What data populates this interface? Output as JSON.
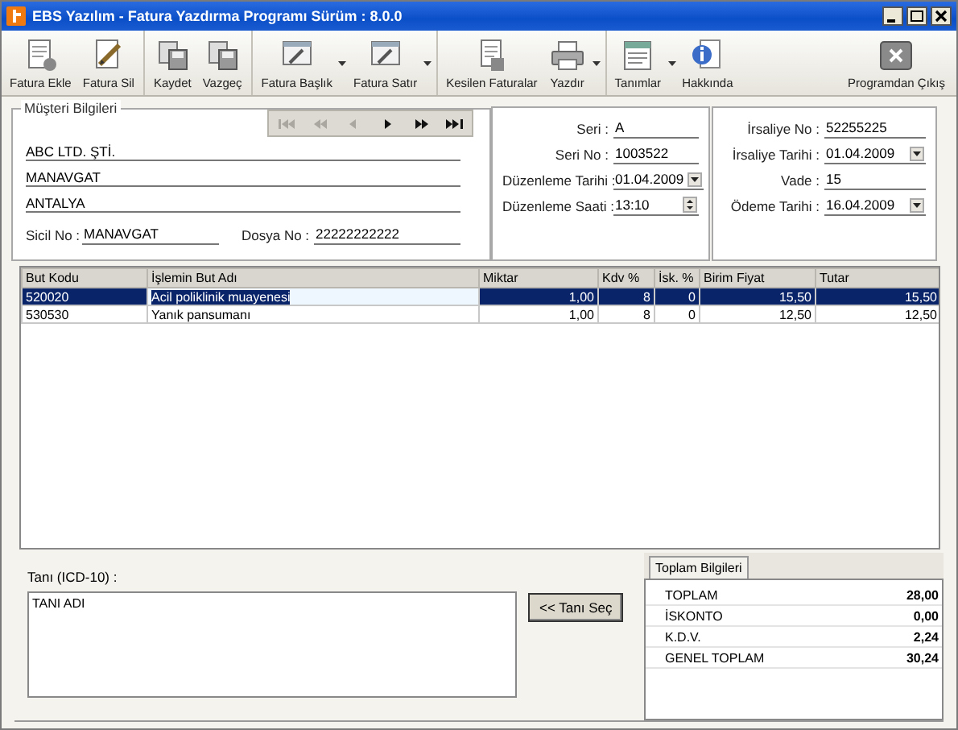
{
  "window": {
    "title": "EBS Yazılım - Fatura Yazdırma Programı Sürüm : 8.0.0"
  },
  "toolbar": {
    "groups": [
      [
        {
          "label": "Fatura Ekle",
          "kind": "add",
          "dropdown": false
        },
        {
          "label": "Fatura Sil",
          "kind": "edit",
          "dropdown": false
        }
      ],
      [
        {
          "label": "Kaydet",
          "kind": "save",
          "dropdown": false
        },
        {
          "label": "Vazgeç",
          "kind": "save",
          "dropdown": false
        }
      ],
      [
        {
          "label": "Fatura Başlık",
          "kind": "layout",
          "dropdown": true
        },
        {
          "label": "Fatura Satır",
          "kind": "layout",
          "dropdown": true
        }
      ],
      [
        {
          "label": "Kesilen Faturalar",
          "kind": "list",
          "dropdown": false
        },
        {
          "label": "Yazdır",
          "kind": "print",
          "dropdown": true
        }
      ],
      [
        {
          "label": "Tanımlar",
          "kind": "form",
          "dropdown": true
        },
        {
          "label": "Hakkında",
          "kind": "info",
          "dropdown": false
        },
        {
          "label": "Programdan Çıkış",
          "kind": "exit",
          "dropdown": false
        }
      ]
    ]
  },
  "customer": {
    "title": "Müşteri Bilgileri",
    "navigator": [
      {
        "kind": "first",
        "disabled": true
      },
      {
        "kind": "prev_page",
        "disabled": true
      },
      {
        "kind": "prev",
        "disabled": true
      },
      {
        "kind": "next",
        "disabled": false
      },
      {
        "kind": "next_page",
        "disabled": false
      },
      {
        "kind": "last",
        "disabled": false
      }
    ],
    "lines": [
      "ABC LTD. ŞTİ.",
      "MANAVGAT",
      "ANTALYA"
    ],
    "fields": [
      {
        "label": "Sicil No :",
        "value": "MANAVGAT"
      },
      {
        "label": "Dosya No :",
        "value": "22222222222"
      }
    ]
  },
  "invoice": {
    "fields": [
      {
        "label": "Seri :",
        "value": "A",
        "kind": "text"
      },
      {
        "label": "Seri No :",
        "value": "1003522",
        "kind": "text"
      },
      {
        "label": "Düzenleme Tarihi :",
        "value": "01.04.2009",
        "kind": "date"
      },
      {
        "label": "Düzenleme Saati :",
        "value": "13:10",
        "kind": "time"
      }
    ]
  },
  "waybill": {
    "fields": [
      {
        "label": "İrsaliye No :",
        "value": "52255225",
        "kind": "text"
      },
      {
        "label": "İrsaliye Tarihi :",
        "value": "01.04.2009",
        "kind": "date"
      },
      {
        "label": "Vade :",
        "value": "15",
        "kind": "text"
      },
      {
        "label": "Ödeme Tarihi :",
        "value": "16.04.2009",
        "kind": "date"
      }
    ]
  },
  "grid": {
    "columns": [
      "But Kodu",
      "İşlemin But Adı",
      "Miktar",
      "Kdv %",
      "İsk. %",
      "Birim Fiyat",
      "Tutar"
    ],
    "rows": [
      {
        "cells": [
          "520020",
          "Acil poliklinik muayenesi",
          "1,00",
          "8",
          "0",
          "15,50",
          "15,50"
        ],
        "selected": true
      },
      {
        "cells": [
          "530530",
          "Yanık pansumanı",
          "1,00",
          "8",
          "0",
          "12,50",
          "12,50"
        ],
        "selected": false
      }
    ]
  },
  "diagnosis": {
    "label": "Tanı (ICD-10) :",
    "value": "TANI ADI",
    "button": "<< Tanı Seç"
  },
  "totals": {
    "tab": "Toplam Bilgileri",
    "rows": [
      {
        "label": "TOPLAM",
        "value": "28,00"
      },
      {
        "label": "İSKONTO",
        "value": "0,00"
      },
      {
        "label": "K.D.V.",
        "value": "2,24"
      },
      {
        "label": "GENEL TOPLAM",
        "value": "30,24"
      }
    ]
  }
}
